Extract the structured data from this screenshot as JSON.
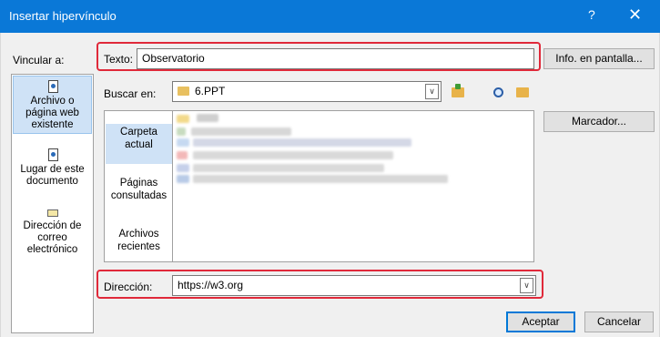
{
  "window": {
    "title": "Insertar hipervínculo",
    "help_glyph": "?",
    "close_glyph": "✕"
  },
  "link_to": {
    "label": "Vincular a:",
    "items": [
      {
        "line1": "Archivo o",
        "line2": "página web",
        "line3": "existente",
        "icon": "document-icon",
        "selected": true
      },
      {
        "line1": "Lugar de este",
        "line2": "documento",
        "line3": "",
        "icon": "document-place-icon",
        "selected": false
      },
      {
        "line1": "Dirección de",
        "line2": "correo",
        "line3": "electrónico",
        "icon": "email-icon",
        "selected": false
      }
    ]
  },
  "text_field": {
    "label": "Texto:",
    "value": "Observatorio"
  },
  "screentip_button": "Info. en pantalla...",
  "look_in": {
    "label": "Buscar en:",
    "value": "6.PPT",
    "folder_icon": "folder-icon"
  },
  "bookmark_button": "Marcador...",
  "places": [
    {
      "line1": "Carpeta",
      "line2": "actual",
      "selected": true
    },
    {
      "line1": "Páginas",
      "line2": "consultadas",
      "selected": false
    },
    {
      "line1": "Archivos",
      "line2": "recientes",
      "selected": false
    }
  ],
  "address": {
    "label": "Dirección:",
    "value": "https://w3.org"
  },
  "buttons": {
    "ok": "Aceptar",
    "cancel": "Cancelar"
  },
  "colors": {
    "title_bar": "#0a78d7",
    "highlight_box": "#e0293a",
    "selection": "#cfe2f6"
  }
}
